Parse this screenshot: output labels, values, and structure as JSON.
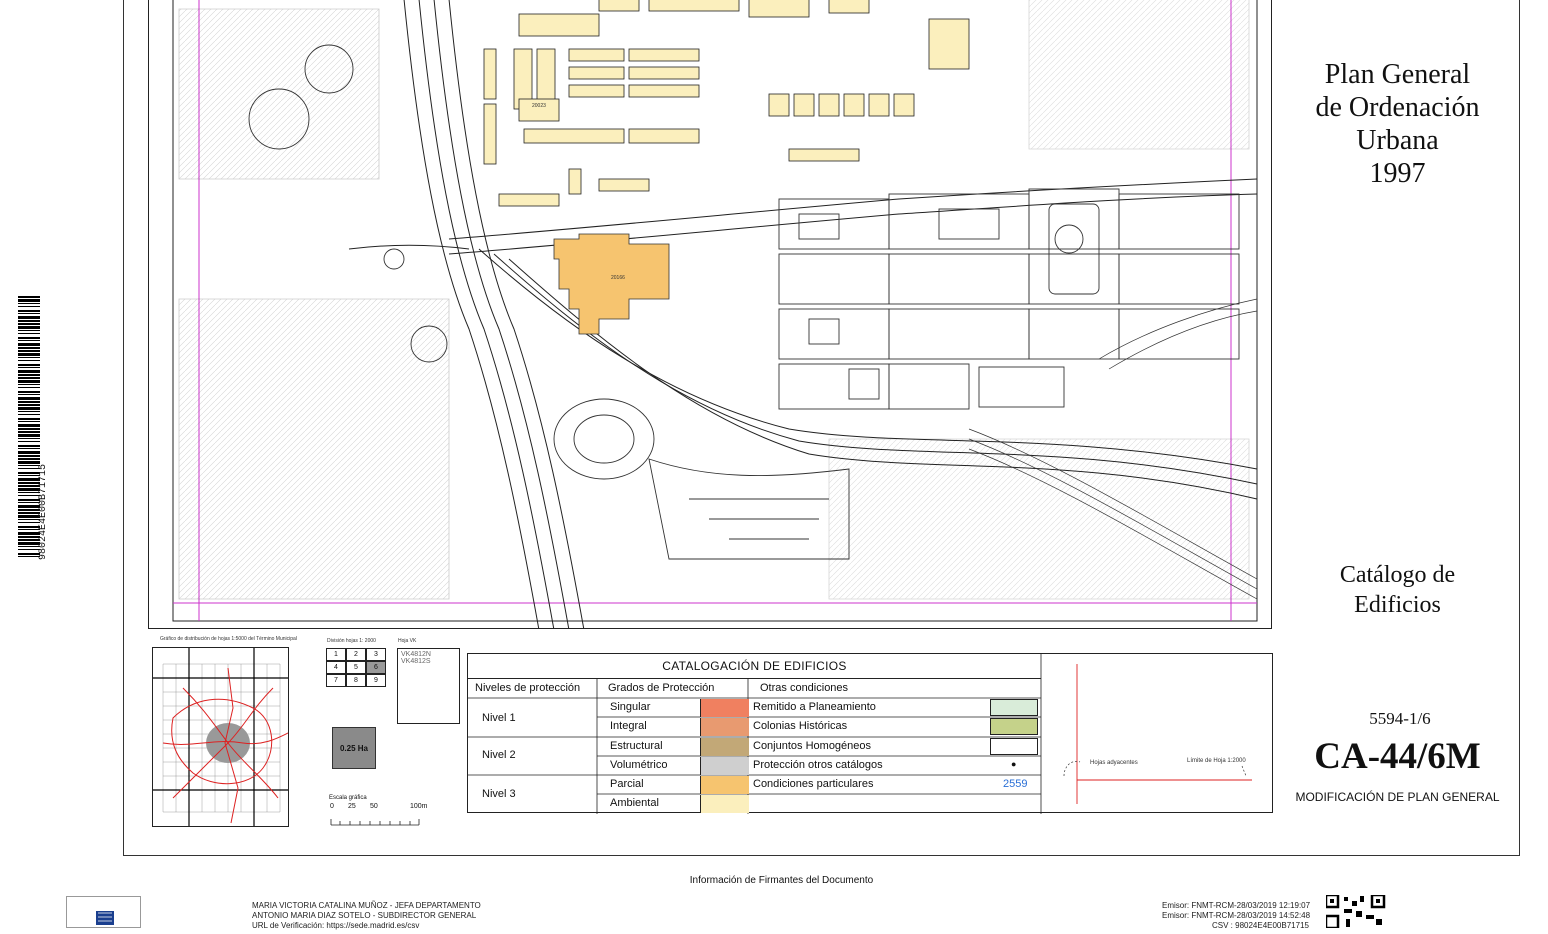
{
  "title": {
    "line1": "Plan General",
    "line2": "de Ordenación",
    "line3": "Urbana",
    "line4": "1997"
  },
  "catalog": {
    "line1": "Catálogo de",
    "line2": "Edificios"
  },
  "sheet": {
    "number": "5594-1/6",
    "code": "CA-44/6M",
    "modification": "MODIFICACIÓN DE PLAN GENERAL"
  },
  "barcode_text": "98024E4E00B71715",
  "map": {
    "labels": {
      "building_number": "20166",
      "building_number_2": "20023"
    },
    "colors": {
      "orange": "#f6c46f",
      "yellow": "#fbefbd",
      "magenta": "#cc33cc"
    }
  },
  "index_maps": {
    "distribution_title": "Gráfico de distribución de hojas 1:5000 del Término Municipal",
    "division_title": "División hojas 1: 2000",
    "vk_title": "Hoja VK",
    "division_cells": [
      "1",
      "2",
      "3",
      "4",
      "5",
      "6",
      "7",
      "8",
      "9"
    ],
    "vk_codes": [
      "VK4812N",
      "VK4812S"
    ],
    "area_badge": "0.25 Ha",
    "scale_title": "Escala gráfica",
    "scale_ticks": [
      "0",
      "25",
      "50",
      "100m"
    ]
  },
  "legend": {
    "title": "CATALOGACIÓN DE EDIFICIOS",
    "headers": {
      "levels": "Niveles de protección",
      "grades": "Grados de Protección",
      "other": "Otras condiciones"
    },
    "levels": [
      "Nivel   1",
      "Nivel   2",
      "Nivel   3"
    ],
    "grades": [
      {
        "label": "Singular",
        "color": "#f08060"
      },
      {
        "label": "Integral",
        "color": "#e89a70"
      },
      {
        "label": "Estructural",
        "color": "#c2a877"
      },
      {
        "label": "Volumétrico",
        "color": "#cfcfcf"
      },
      {
        "label": "Parcial",
        "color": "#f6c46f"
      },
      {
        "label": "Ambiental",
        "color": "#fbefbd"
      }
    ],
    "other": [
      {
        "label": "Remitido a Planeamiento",
        "swatch": "#d9ecd9"
      },
      {
        "label": "Colonias Históricas",
        "swatch": "#c5d28a"
      },
      {
        "label": "Conjuntos Homogéneos",
        "swatch": "#ffffff"
      },
      {
        "label": "Protección otros catálogos",
        "mark": "●"
      },
      {
        "label": "Condiciones particulares",
        "mark": "2559"
      }
    ],
    "adjacent_label": "Hojas adyacentes",
    "limit_label": "Límite de Hoja 1:2000"
  },
  "footer": {
    "heading": "Información de Firmantes del Documento",
    "signer1": "MARIA VICTORIA CATALINA MUÑOZ - JEFA DEPARTAMENTO",
    "signer2": "ANTONIO MARIA DIAZ SOTELO - SUBDIRECTOR GENERAL",
    "url": "URL de Verificación: https://sede.madrid.es/csv",
    "emisor1": "Emisor: FNMT-RCM-28/03/2019 12:19:07",
    "emisor2": "Emisor: FNMT-RCM-28/03/2019 14:52:48",
    "csv": "CSV : 98024E4E00B71715"
  }
}
